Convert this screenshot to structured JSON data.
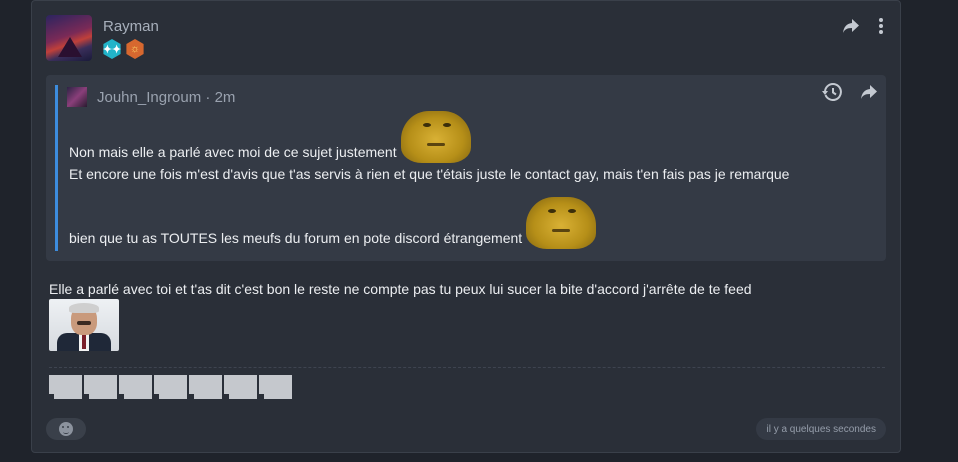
{
  "post": {
    "author": "Rayman",
    "badges": [
      {
        "name": "stars-badge",
        "glyph": "✦✦",
        "color": "#22b4c9"
      },
      {
        "name": "sun-badge",
        "glyph": "☼",
        "color": "#d7682f"
      }
    ],
    "quote": {
      "author": "Jouhn_Ingroum",
      "separator": "·",
      "time": "2m",
      "lines": [
        "Non mais elle a parlé avec moi de ce sujet justement",
        "Et encore une fois m'est d'avis que t'as servis à rien et que t'étais juste le contact gay, mais t'en fais pas je remarque",
        "bien que tu as TOUTES les meufs du forum en pote discord étrangement"
      ]
    },
    "body_text": "Elle a parlé avec toi et t'as dit c'est bon le reste ne compte pas tu peux lui sucer la bite d'accord j'arrête de te feed",
    "thumbnail_count": 7,
    "timestamp": "il y a quelques secondes"
  },
  "icons": {
    "share": "share-arrow-icon",
    "more": "kebab-menu-icon",
    "history": "history-icon",
    "react": "emoji-reaction-icon"
  },
  "colors": {
    "background": "#1f232b",
    "card": "#2a2f38",
    "quote_bg": "#343a45",
    "quote_accent": "#3d8cdd"
  }
}
